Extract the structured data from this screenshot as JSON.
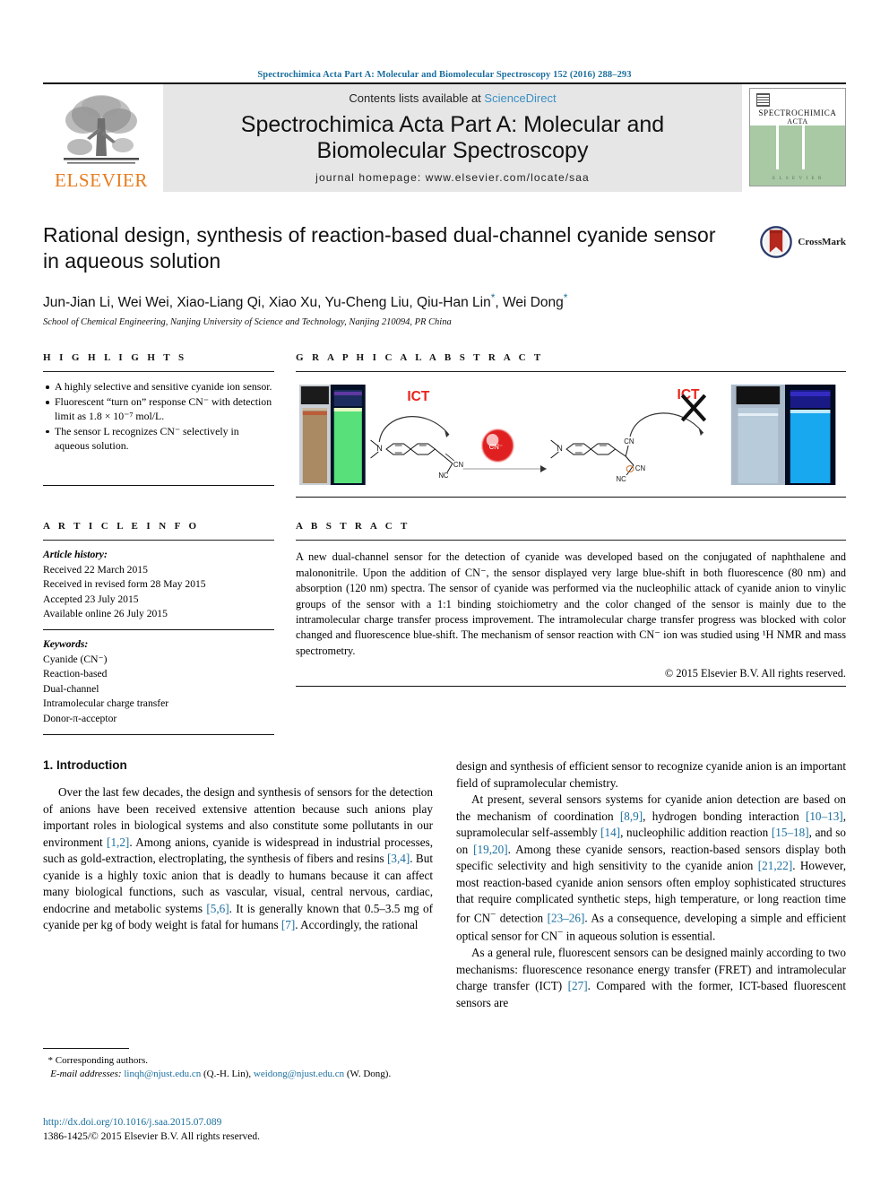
{
  "running_head": "Spectrochimica Acta Part A: Molecular and Biomolecular Spectroscopy 152 (2016) 288–293",
  "masthead": {
    "publisher": "ELSEVIER",
    "contents_prefix": "Contents lists available at ",
    "contents_link": "ScienceDirect",
    "journal_title_line1": "Spectrochimica Acta Part A: Molecular and",
    "journal_title_line2": "Biomolecular Spectroscopy",
    "homepage": "journal homepage: www.elsevier.com/locate/saa",
    "cover": {
      "title_line1": "SPECTROCHIMICA",
      "title_line2": "ACTA",
      "footer": "E L S E V I E R"
    }
  },
  "title": "Rational design, synthesis of reaction-based dual-channel cyanide sensor in aqueous solution",
  "crossmark_label": "CrossMark",
  "authors": "Jun-Jian Li, Wei Wei, Xiao-Liang Qi, Xiao Xu, Yu-Cheng Liu, Qiu-Han Lin",
  "authors_tail": ", Wei Dong",
  "affiliation": "School of Chemical Engineering, Nanjing University of Science and Technology, Nanjing 210094, PR China",
  "sections": {
    "highlights_heading": "H I G H L I G H T S",
    "graphical_abstract_heading": "G R A P H I C A L   A B S T R A C T",
    "article_info_heading": "A R T I C L E   I N F O",
    "abstract_heading": "A B S T R A C T"
  },
  "highlights": [
    "A highly selective and sensitive cyanide ion sensor.",
    "Fluorescent “turn on” response CN⁻ with detection limit as 1.8 × 10⁻⁷ mol/L.",
    "The sensor L recognizes CN⁻ selectively in aqueous solution."
  ],
  "article_history": {
    "label": "Article history:",
    "received": "Received 22 March 2015",
    "revised": "Received in revised form 28 May 2015",
    "accepted": "Accepted 23 July 2015",
    "online": "Available online 26 July 2015"
  },
  "keywords": {
    "label": "Keywords:",
    "items": [
      "Cyanide (CN⁻)",
      "Reaction-based",
      "Dual-channel",
      "Intramolecular charge transfer",
      "Donor-π-acceptor"
    ]
  },
  "abstract": "A new dual-channel sensor for the detection of cyanide was developed based on the conjugated of naphthalene and malononitrile. Upon the addition of CN⁻, the sensor displayed very large blue-shift in both fluorescence (80 nm) and absorption (120 nm) spectra. The sensor of cyanide was performed via the nucleophilic attack of cyanide anion to vinylic groups of the sensor with a 1:1 binding stoichiometry and the color changed of the sensor is mainly due to the intramolecular charge transfer process improvement. The intramolecular charge transfer progress was blocked with color changed and fluorescence blue-shift. The mechanism of sensor reaction with CN⁻ ion was studied using ¹H NMR and mass spectrometry.",
  "abstract_copyright": "© 2015 Elsevier B.V. All rights reserved.",
  "graphical_abstract": {
    "ict_label_left": "ICT",
    "ict_label_right": "ICT",
    "blocked_marker": "X",
    "ion_label": "CN⁻",
    "atom_labels": [
      "N",
      "CN",
      "NC",
      "CN",
      "NC",
      "N",
      "CN",
      "CN",
      "NC"
    ]
  },
  "body": {
    "intro_heading": "1. Introduction",
    "left_paragraphs": [
      "Over the last few decades, the design and synthesis of sensors for the detection of anions have been received extensive attention because such anions play important roles in biological systems and also constitute some pollutants in our environment [1,2]. Among anions, cyanide is widespread in industrial processes, such as gold-extraction, electroplating, the synthesis of fibers and resins [3,4]. But cyanide is a highly toxic anion that is deadly to humans because it can affect many biological functions, such as vascular, visual, central nervous, cardiac, endocrine and metabolic systems [5,6]. It is generally known that 0.5–3.5 mg of cyanide per kg of body weight is fatal for humans [7]. Accordingly, the rational"
    ],
    "right_paragraphs": [
      "design and synthesis of efficient sensor to recognize cyanide anion is an important field of supramolecular chemistry.",
      "At present, several sensors systems for cyanide anion detection are based on the mechanism of coordination [8,9], hydrogen bonding interaction [10–13], supramolecular self-assembly [14], nucleophilic addition reaction [15–18], and so on [19,20]. Among these cyanide sensors, reaction-based sensors display both specific selectivity and high sensitivity to the cyanide anion [21,22]. However, most reaction-based cyanide anion sensors often employ sophisticated structures that require complicated synthetic steps, high temperature, or long reaction time for CN⁻ detection [23–26]. As a consequence, developing a simple and efficient optical sensor for CN⁻ in aqueous solution is essential.",
      "As a general rule, fluorescent sensors can be designed mainly according to two mechanisms: fluorescence resonance energy transfer (FRET) and intramolecular charge transfer (ICT) [27]. Compared with the former, ICT-based fluorescent sensors are"
    ]
  },
  "footnote": {
    "corresponding": "Corresponding authors.",
    "email_label": "E-mail addresses:",
    "email1": "linqh@njust.edu.cn",
    "email1_owner": "(Q.-H. Lin),",
    "email2": "weidong@njust.edu.cn",
    "email2_owner": "(W. Dong)."
  },
  "bottom": {
    "doi": "http://dx.doi.org/10.1016/j.saa.2015.07.089",
    "issn_line": "1386-1425/© 2015 Elsevier B.V. All rights reserved."
  },
  "colors": {
    "link": "#1a6e9e",
    "sciencedirect": "#3a8fc4",
    "elsevier_orange": "#E87C1E",
    "ict_red": "#e8251b",
    "cover_green": "#a8c9a4",
    "band_gray": "#e6e6e6"
  }
}
